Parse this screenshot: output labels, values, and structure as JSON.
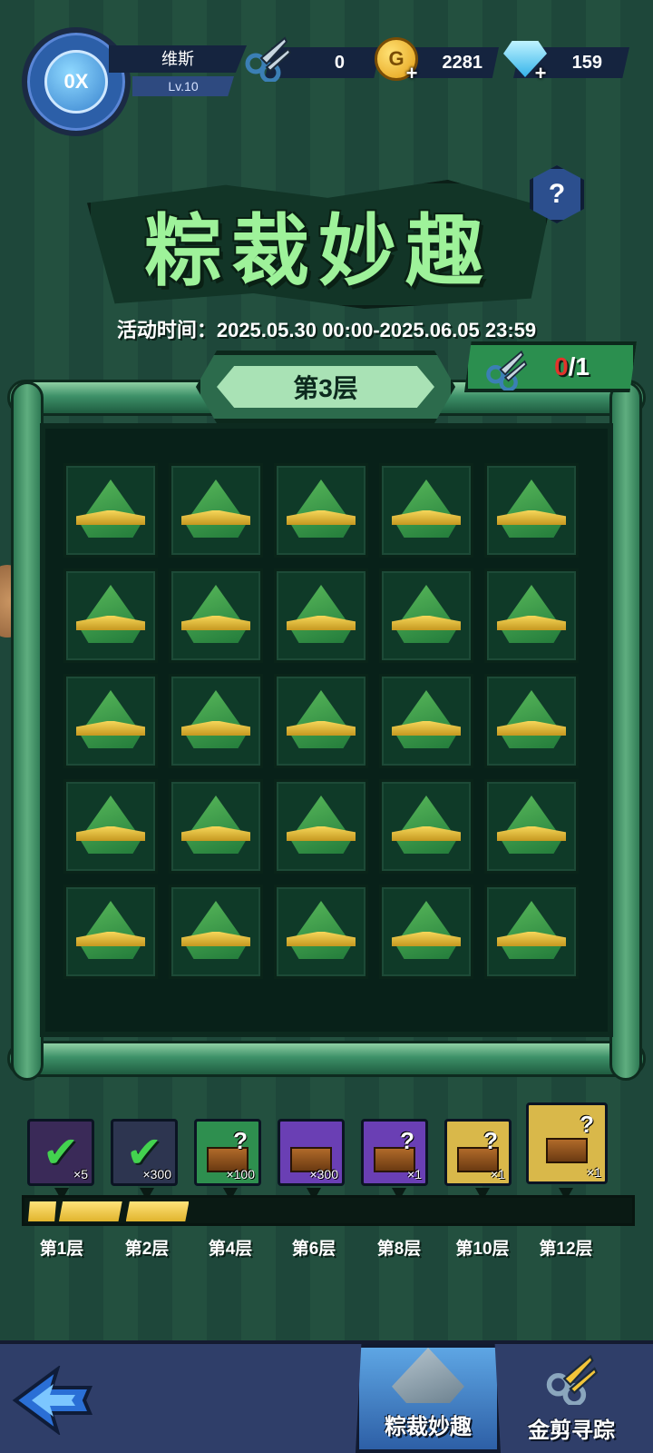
{
  "player": {
    "name": "维斯",
    "level": "Lv.10",
    "avatar_label": "0X"
  },
  "resources": {
    "scissors": "0",
    "gold": "2281",
    "diamonds": "159"
  },
  "event": {
    "title": "粽裁妙趣",
    "time": "活动时间：2025.05.30 00:00-2025.06.05 23:59",
    "floor_label": "第3层",
    "scissor_current": "0",
    "scissor_sep_total": "/1"
  },
  "board": {
    "rows": 5,
    "cols": 5,
    "cell_item": "zongzi-icon"
  },
  "rewards": [
    {
      "floor": "第1层",
      "qty": "×5",
      "claimed": true,
      "bg": "#3a2a58"
    },
    {
      "floor": "第2层",
      "qty": "×300",
      "claimed": true,
      "bg": "#2d3550"
    },
    {
      "floor": "第4层",
      "qty": "×100",
      "claimed": false,
      "bg": "#2e8f4f"
    },
    {
      "floor": "第6层",
      "qty": "×300",
      "claimed": false,
      "bg": "#6a3fb4"
    },
    {
      "floor": "第8层",
      "qty": "×1",
      "claimed": false,
      "bg": "#6a3fb4"
    },
    {
      "floor": "第10层",
      "qty": "×1",
      "claimed": false,
      "bg": "#d9b84a"
    },
    {
      "floor": "第12层",
      "qty": "×1",
      "claimed": false,
      "bg": "#d9b84a"
    }
  ],
  "progress": {
    "filled_segments": 3,
    "total_segments": 9
  },
  "nav": {
    "back_icon": "back-arrow-icon",
    "tab_active_label": "粽裁妙趣",
    "tab_other_label": "金剪寻踪"
  },
  "colors": {
    "accent_green": "#9ef29a",
    "counter_red": "#e2332b",
    "progress_gold": "#e1b52d"
  }
}
